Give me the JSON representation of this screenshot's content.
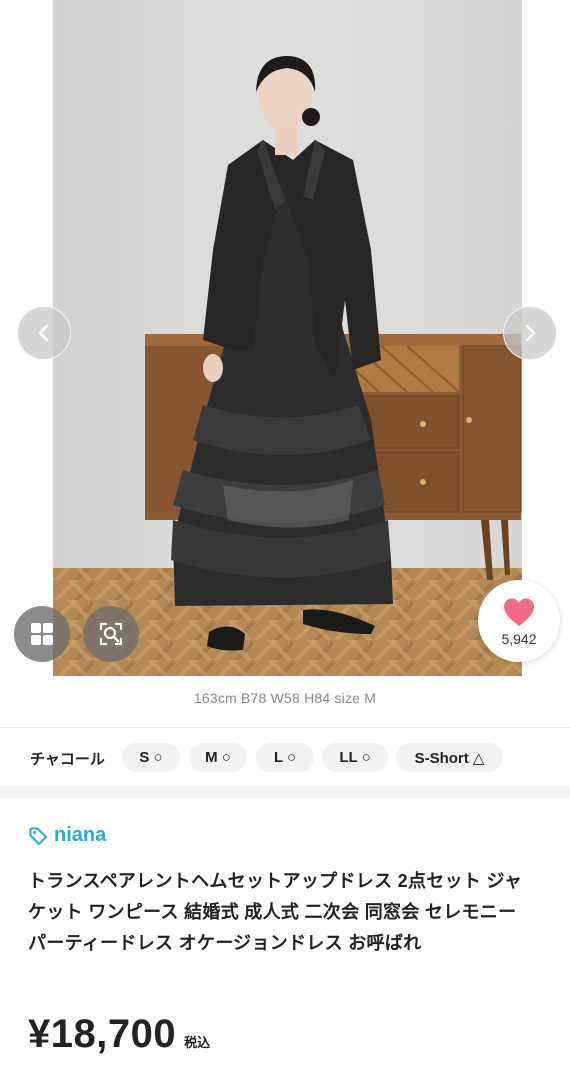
{
  "gallery": {
    "image_alt": "model wearing charcoal set-up dress in front of wooden sideboard",
    "prev_icon": "chevron-left-icon",
    "next_icon": "chevron-right-icon",
    "grid_icon": "grid-icon",
    "zoom_icon": "image-search-icon",
    "like_icon": "heart-icon",
    "like_count": "5,942",
    "colors": {
      "heart": "#ef6a82",
      "wall": "#d9d9d7",
      "dress": "#2f2f2f",
      "floor": "#a9783f"
    }
  },
  "model_caption": "163cm B78 W58 H84 size M",
  "variant": {
    "color_name": "チャコール",
    "sizes": [
      {
        "label": "S ○"
      },
      {
        "label": "M ○"
      },
      {
        "label": "L ○"
      },
      {
        "label": "LL ○"
      },
      {
        "label": "S-Short △"
      }
    ]
  },
  "shop": {
    "icon": "tag-icon",
    "name": "niana",
    "color": "#2aa8d8"
  },
  "product": {
    "title": "トランスペアレントヘムセットアップドレス 2点セット ジャケット ワンピース 結婚式 成人式 二次会 同窓会 セレモニー パーティードレス オケージョンドレス お呼ばれ",
    "price": "¥18,700",
    "tax_label": "税込"
  }
}
